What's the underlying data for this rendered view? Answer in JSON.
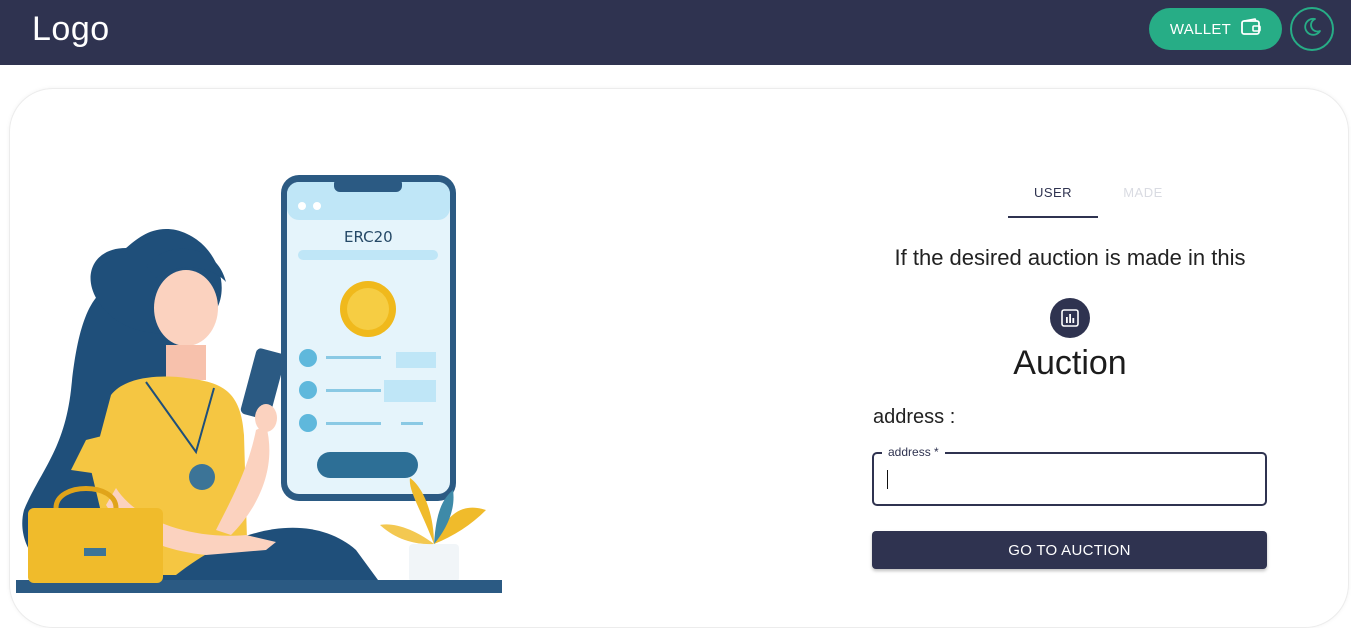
{
  "header": {
    "logo": "Logo",
    "wallet_label": "WALLET",
    "wallet_icon": "wallet-icon",
    "theme_icon": "moon-icon"
  },
  "illustration": {
    "phone_title": "ERC20"
  },
  "tabs": [
    {
      "label": "USER",
      "active": true
    },
    {
      "label": "MADE",
      "active": false
    }
  ],
  "main": {
    "description": "If the desired auction is made in this",
    "icon": "bar-chart-icon",
    "title": "Auction",
    "address_label": "address :",
    "address_field": {
      "legend": "address *",
      "value": ""
    },
    "submit_label": "GO TO AUCTION"
  },
  "colors": {
    "header_bg": "#2f3350",
    "accent_green": "#27ad86",
    "button_bg": "#2f3350"
  }
}
